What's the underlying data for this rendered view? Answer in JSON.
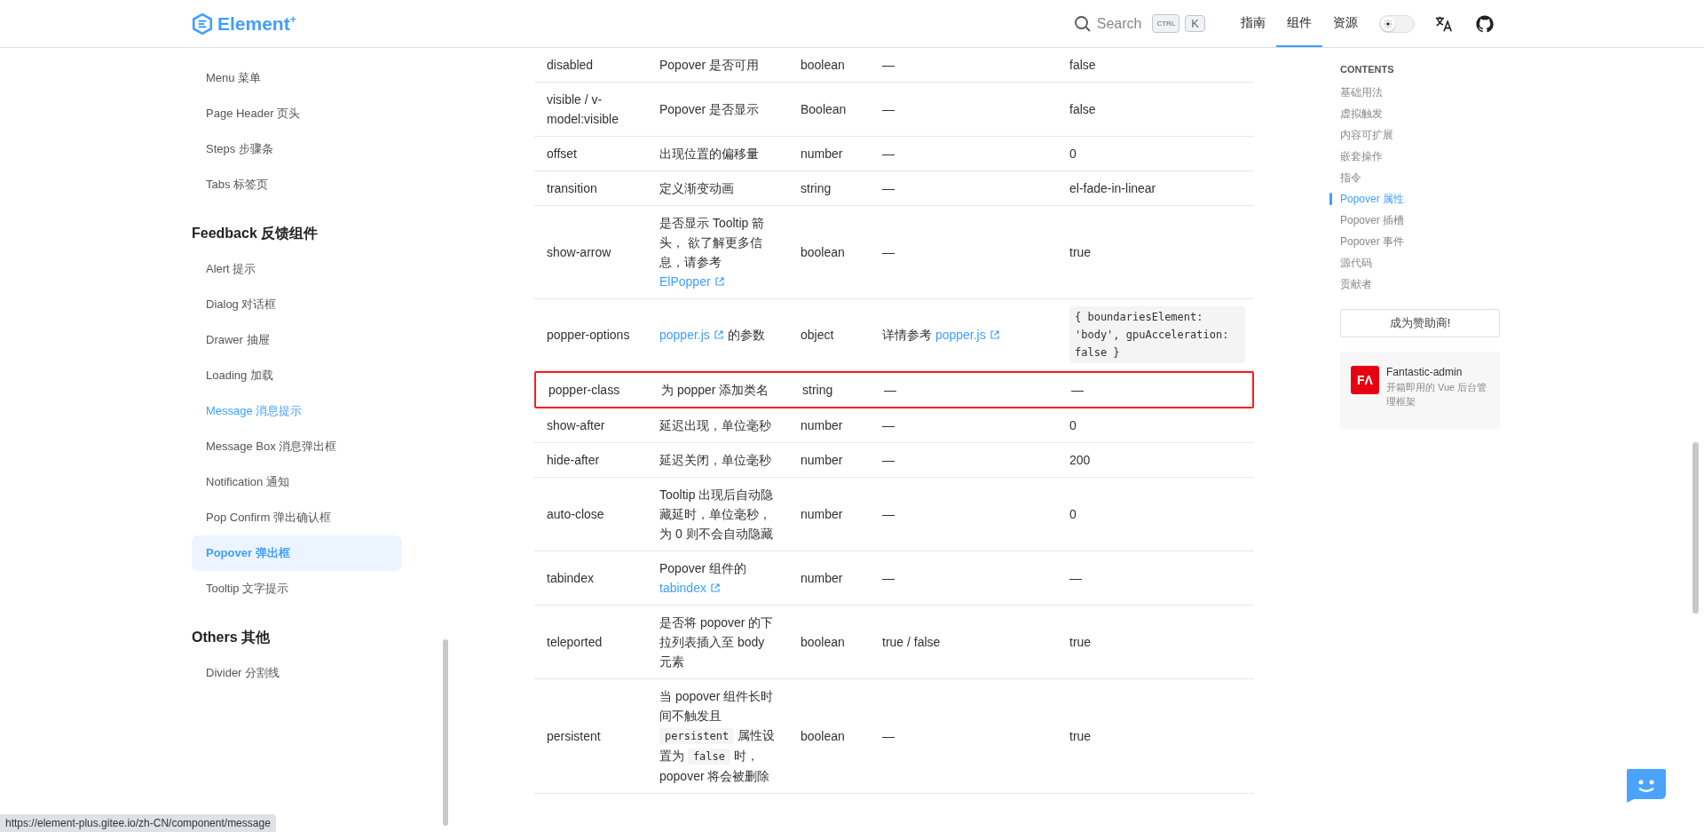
{
  "header": {
    "logo": {
      "text": "Element",
      "sup": "+"
    },
    "search": {
      "placeholder": "Search",
      "keys": [
        "CTRL",
        "K"
      ]
    },
    "nav": [
      {
        "label": "指南",
        "selected": false
      },
      {
        "label": "组件",
        "selected": true
      },
      {
        "label": "资源",
        "selected": false
      }
    ],
    "theme_switch": {
      "on": false
    }
  },
  "sidebar": {
    "groups": [
      {
        "items": [
          {
            "label": "Menu 菜单",
            "selected": false,
            "hovered": false
          },
          {
            "label": "Page Header 页头",
            "selected": false,
            "hovered": false
          },
          {
            "label": "Steps 步骤条",
            "selected": false,
            "hovered": false
          },
          {
            "label": "Tabs 标签页",
            "selected": false,
            "hovered": false
          }
        ]
      },
      {
        "title": "Feedback 反馈组件",
        "items": [
          {
            "label": "Alert 提示",
            "selected": false,
            "hovered": false
          },
          {
            "label": "Dialog 对话框",
            "selected": false,
            "hovered": false
          },
          {
            "label": "Drawer 抽屉",
            "selected": false,
            "hovered": false
          },
          {
            "label": "Loading 加载",
            "selected": false,
            "hovered": false
          },
          {
            "label": "Message 消息提示",
            "selected": false,
            "hovered": true
          },
          {
            "label": "Message Box 消息弹出框",
            "selected": false,
            "hovered": false
          },
          {
            "label": "Notification 通知",
            "selected": false,
            "hovered": false
          },
          {
            "label": "Pop Confirm 弹出确认框",
            "selected": false,
            "hovered": false
          },
          {
            "label": "Popover 弹出框",
            "selected": true,
            "hovered": false
          },
          {
            "label": "Tooltip 文字提示",
            "selected": false,
            "hovered": false
          }
        ]
      },
      {
        "title": "Others 其他",
        "items": [
          {
            "label": "Divider 分割线",
            "selected": false,
            "hovered": false
          }
        ]
      }
    ]
  },
  "table": {
    "rows": [
      {
        "highlighted": false,
        "cells": [
          [
            {
              "kind": "text",
              "text": "disabled"
            }
          ],
          [
            {
              "kind": "text",
              "text": "Popover 是否可用"
            }
          ],
          [
            {
              "kind": "text",
              "text": "boolean"
            }
          ],
          [
            {
              "kind": "text",
              "text": "—"
            }
          ],
          [
            {
              "kind": "text",
              "text": "false"
            }
          ]
        ]
      },
      {
        "highlighted": false,
        "cells": [
          [
            {
              "kind": "text",
              "text": "visible / v-model:visible"
            }
          ],
          [
            {
              "kind": "text",
              "text": "Popover 是否显示"
            }
          ],
          [
            {
              "kind": "text",
              "text": "Boolean"
            }
          ],
          [
            {
              "kind": "text",
              "text": "—"
            }
          ],
          [
            {
              "kind": "text",
              "text": "false"
            }
          ]
        ]
      },
      {
        "highlighted": false,
        "cells": [
          [
            {
              "kind": "text",
              "text": "offset"
            }
          ],
          [
            {
              "kind": "text",
              "text": "出现位置的偏移量"
            }
          ],
          [
            {
              "kind": "text",
              "text": "number"
            }
          ],
          [
            {
              "kind": "text",
              "text": "—"
            }
          ],
          [
            {
              "kind": "text",
              "text": "0"
            }
          ]
        ]
      },
      {
        "highlighted": false,
        "cells": [
          [
            {
              "kind": "text",
              "text": "transition"
            }
          ],
          [
            {
              "kind": "text",
              "text": "定义渐变动画"
            }
          ],
          [
            {
              "kind": "text",
              "text": "string"
            }
          ],
          [
            {
              "kind": "text",
              "text": "—"
            }
          ],
          [
            {
              "kind": "text",
              "text": "el-fade-in-linear"
            }
          ]
        ]
      },
      {
        "highlighted": false,
        "cells": [
          [
            {
              "kind": "text",
              "text": "show-arrow"
            }
          ],
          [
            {
              "kind": "text",
              "text": "是否显示 Tooltip 箭头， 欲了解更多信息，请参考 "
            },
            {
              "kind": "link",
              "text": "ElPopper"
            }
          ],
          [
            {
              "kind": "text",
              "text": "boolean"
            }
          ],
          [
            {
              "kind": "text",
              "text": "—"
            }
          ],
          [
            {
              "kind": "text",
              "text": "true"
            }
          ]
        ]
      },
      {
        "highlighted": false,
        "cells": [
          [
            {
              "kind": "text",
              "text": "popper-options"
            }
          ],
          [
            {
              "kind": "link",
              "text": "popper.js"
            },
            {
              "kind": "text",
              "text": " 的参数"
            }
          ],
          [
            {
              "kind": "text",
              "text": "object"
            }
          ],
          [
            {
              "kind": "text",
              "text": "详情参考 "
            },
            {
              "kind": "link",
              "text": "popper.js"
            }
          ],
          [
            {
              "kind": "code",
              "text": "{ boundariesElement: 'body', gpuAcceleration: false }"
            }
          ]
        ]
      },
      {
        "highlighted": true,
        "cells": [
          [
            {
              "kind": "text",
              "text": "popper-class"
            }
          ],
          [
            {
              "kind": "text",
              "text": "为 popper 添加类名"
            }
          ],
          [
            {
              "kind": "text",
              "text": "string"
            }
          ],
          [
            {
              "kind": "text",
              "text": "—"
            }
          ],
          [
            {
              "kind": "text",
              "text": "—"
            }
          ]
        ]
      },
      {
        "highlighted": false,
        "cells": [
          [
            {
              "kind": "text",
              "text": "show-after"
            }
          ],
          [
            {
              "kind": "text",
              "text": "延迟出现，单位毫秒"
            }
          ],
          [
            {
              "kind": "text",
              "text": "number"
            }
          ],
          [
            {
              "kind": "text",
              "text": "—"
            }
          ],
          [
            {
              "kind": "text",
              "text": "0"
            }
          ]
        ]
      },
      {
        "highlighted": false,
        "cells": [
          [
            {
              "kind": "text",
              "text": "hide-after"
            }
          ],
          [
            {
              "kind": "text",
              "text": "延迟关闭，单位毫秒"
            }
          ],
          [
            {
              "kind": "text",
              "text": "number"
            }
          ],
          [
            {
              "kind": "text",
              "text": "—"
            }
          ],
          [
            {
              "kind": "text",
              "text": "200"
            }
          ]
        ]
      },
      {
        "highlighted": false,
        "cells": [
          [
            {
              "kind": "text",
              "text": "auto-close"
            }
          ],
          [
            {
              "kind": "text",
              "text": "Tooltip 出现后自动隐藏延时，单位毫秒，为 0 则不会自动隐藏"
            }
          ],
          [
            {
              "kind": "text",
              "text": "number"
            }
          ],
          [
            {
              "kind": "text",
              "text": "—"
            }
          ],
          [
            {
              "kind": "text",
              "text": "0"
            }
          ]
        ]
      },
      {
        "highlighted": false,
        "cells": [
          [
            {
              "kind": "text",
              "text": "tabindex"
            }
          ],
          [
            {
              "kind": "text",
              "text": "Popover 组件的 "
            },
            {
              "kind": "link",
              "text": "tabindex"
            }
          ],
          [
            {
              "kind": "text",
              "text": "number"
            }
          ],
          [
            {
              "kind": "text",
              "text": "—"
            }
          ],
          [
            {
              "kind": "text",
              "text": "—"
            }
          ]
        ]
      },
      {
        "highlighted": false,
        "cells": [
          [
            {
              "kind": "text",
              "text": "teleported"
            }
          ],
          [
            {
              "kind": "text",
              "text": "是否将 popover 的下拉列表插入至 body 元素"
            }
          ],
          [
            {
              "kind": "text",
              "text": "boolean"
            }
          ],
          [
            {
              "kind": "text",
              "text": "true / false"
            }
          ],
          [
            {
              "kind": "text",
              "text": "true"
            }
          ]
        ]
      },
      {
        "highlighted": false,
        "cells": [
          [
            {
              "kind": "text",
              "text": "persistent"
            }
          ],
          [
            {
              "kind": "text",
              "text": "当 popover 组件长时间不触发且 "
            },
            {
              "kind": "code",
              "text": "persistent"
            },
            {
              "kind": "text",
              "text": " 属性设置为 "
            },
            {
              "kind": "code",
              "text": "false"
            },
            {
              "kind": "text",
              "text": " 时，popover 将会被删除"
            }
          ],
          [
            {
              "kind": "text",
              "text": "boolean"
            }
          ],
          [
            {
              "kind": "text",
              "text": "—"
            }
          ],
          [
            {
              "kind": "text",
              "text": "true"
            }
          ]
        ]
      }
    ]
  },
  "toc": {
    "title": "CONTENTS",
    "items": [
      {
        "label": "基础用法",
        "selected": false
      },
      {
        "label": "虚拟触发",
        "selected": false
      },
      {
        "label": "内容可扩展",
        "selected": false
      },
      {
        "label": "嵌套操作",
        "selected": false
      },
      {
        "label": "指令",
        "selected": false
      },
      {
        "label": "Popover 属性",
        "selected": true
      },
      {
        "label": "Popover 插槽",
        "selected": false
      },
      {
        "label": "Popover 事件",
        "selected": false
      },
      {
        "label": "源代码",
        "selected": false
      },
      {
        "label": "贡献者",
        "selected": false
      }
    ]
  },
  "sponsor_button": "成为赞助商!",
  "ad": {
    "logo_text": "FΛ",
    "title": "Fantastic-admin",
    "description": "开箱即用的 Vue 后台管理框架"
  },
  "status_url": "https://element-plus.gitee.io/zh-CN/component/message"
}
